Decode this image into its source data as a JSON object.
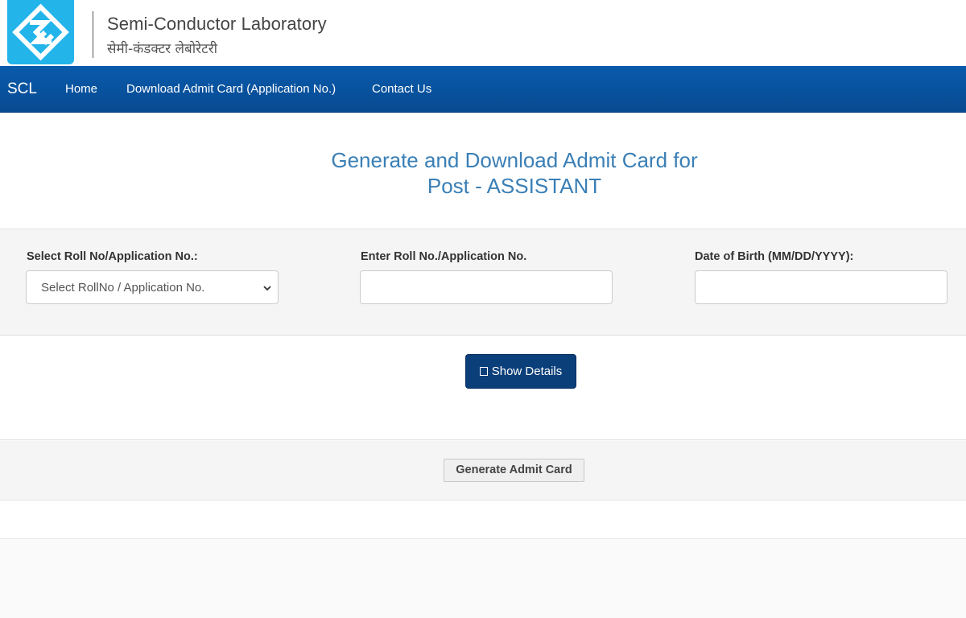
{
  "header": {
    "logo": "scl-logo-icon",
    "org_name_en": "Semi-Conductor Laboratory",
    "org_name_hi": "सेमी-कंडक्टर लेबोरेटरी"
  },
  "nav": {
    "brand": "SCL",
    "items": [
      {
        "label": "Home"
      },
      {
        "label": "Download Admit Card (Application No.)"
      },
      {
        "label": "Contact Us"
      }
    ]
  },
  "title": {
    "line1": "Generate and Download Admit Card for",
    "line2": "Post - ASSISTANT"
  },
  "form": {
    "roll_select_label": "Select Roll No/Application No.:",
    "roll_select_value": "Select RollNo / Application No.",
    "roll_input_label": "Enter Roll No./Application No.",
    "roll_input_value": "",
    "dob_label": "Date of Birth (MM/DD/YYYY):",
    "dob_value": ""
  },
  "actions": {
    "show_details": "Show Details",
    "generate_admit_card": "Generate Admit Card"
  },
  "colors": {
    "navbar": "#074a91",
    "title": "#3a7fb6",
    "primary_button": "#0b3f7a",
    "logo_bg": "#23b4ea"
  }
}
